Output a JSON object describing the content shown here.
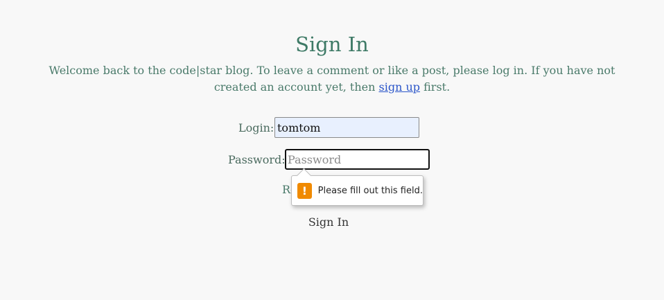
{
  "page": {
    "title": "Sign In",
    "intro_before_link": "Welcome back to the code|star blog. To leave a comment or like a post, please log in. If you have not created an account yet, then ",
    "intro_link": "sign up",
    "intro_after_link": " first."
  },
  "form": {
    "login_label": "Login:",
    "login_value": "tomtom",
    "password_label": "Password:",
    "password_placeholder": "Password",
    "password_value": "",
    "remember_partial": "Re",
    "submit_label": "Sign In"
  },
  "validation": {
    "message": "Please fill out this field.",
    "icon": "warning-icon",
    "icon_glyph": "!"
  },
  "colors": {
    "background": "#f8f8f8",
    "title": "#3e7a66",
    "text": "#4a7a6a",
    "link": "#2a55c9",
    "autofill_bg": "#e8f0fe",
    "warning": "#f08a00"
  }
}
